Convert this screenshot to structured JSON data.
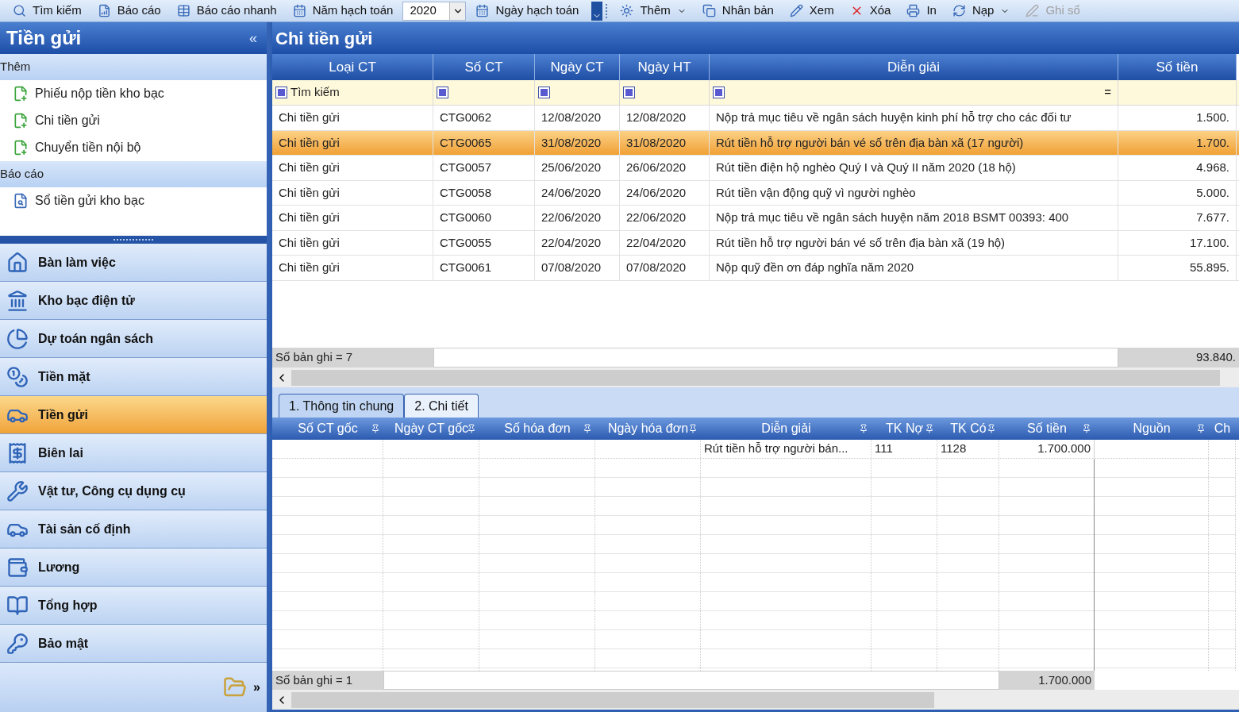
{
  "toolbar": {
    "items": [
      {
        "kind": "button",
        "label": "Tìm kiếm",
        "disabled": false
      },
      {
        "kind": "button",
        "label": "Báo cáo",
        "disabled": false
      },
      {
        "kind": "button",
        "label": "Báo cáo nhanh",
        "disabled": false
      },
      {
        "kind": "label",
        "label": "Năm hạch toán"
      },
      {
        "kind": "select",
        "value": "2020"
      },
      {
        "kind": "button",
        "label": "Ngày hạch toán",
        "disabled": false
      },
      {
        "kind": "overflow"
      },
      {
        "kind": "menu",
        "label": "Thêm",
        "disabled": false
      },
      {
        "kind": "button",
        "label": "Nhân bản",
        "disabled": false
      },
      {
        "kind": "button",
        "label": "Xem",
        "disabled": false
      },
      {
        "kind": "button",
        "label": "Xóa",
        "disabled": false
      },
      {
        "kind": "button",
        "label": "In",
        "disabled": false
      },
      {
        "kind": "menu",
        "label": "Nạp",
        "disabled": false
      },
      {
        "kind": "button",
        "label": "Ghi sổ",
        "disabled": true
      }
    ]
  },
  "sidebar": {
    "title": "Tiền gửi",
    "collapse": "«",
    "groups": [
      {
        "title": "Thêm",
        "items": [
          "Phiếu nộp tiền kho bạc",
          "Chi tiền gửi",
          "Chuyển tiền nội bộ"
        ]
      },
      {
        "title": "Báo cáo",
        "items": [
          "Sổ tiền gửi kho bạc"
        ]
      }
    ],
    "nav": [
      {
        "label": "Bàn làm việc",
        "selected": false
      },
      {
        "label": "Kho bạc điện tử",
        "selected": false
      },
      {
        "label": "Dự toán ngân sách",
        "selected": false
      },
      {
        "label": "Tiền mặt",
        "selected": false
      },
      {
        "label": "Tiền gửi",
        "selected": true
      },
      {
        "label": "Biên lai",
        "selected": false
      },
      {
        "label": "Vật tư, Công cụ dụng cụ",
        "selected": false
      },
      {
        "label": "Tài sản cố định",
        "selected": false
      },
      {
        "label": "Lương",
        "selected": false
      },
      {
        "label": "Tổng hợp",
        "selected": false
      },
      {
        "label": "Bảo mật",
        "selected": false
      }
    ],
    "more": "»"
  },
  "main": {
    "title": "Chi tiền gửi",
    "grid": {
      "columns": [
        "Loại CT",
        "Số CT",
        "Ngày CT",
        "Ngày HT",
        "Diễn giải",
        "Số tiền"
      ],
      "filter": {
        "placeholder": "Tìm kiếm",
        "operator": "="
      },
      "rows": [
        {
          "cells": [
            "Chi tiền gửi",
            "CTG0062",
            "12/08/2020",
            "12/08/2020",
            "Nộp trả mục tiêu về ngân sách huyện kinh phí hỗ trợ cho các đối tư",
            "1.500."
          ],
          "selected": false
        },
        {
          "cells": [
            "Chi tiền gửi",
            "CTG0065",
            "31/08/2020",
            "31/08/2020",
            "Rút tiền hỗ trợ người bán vé số trên địa bàn xã (17 người)",
            "1.700."
          ],
          "selected": true
        },
        {
          "cells": [
            "Chi tiền gửi",
            "CTG0057",
            "25/06/2020",
            "26/06/2020",
            "Rút tiền điện hộ nghèo Quý I và Quý II năm 2020 (18 hộ)",
            "4.968."
          ],
          "selected": false
        },
        {
          "cells": [
            "Chi tiền gửi",
            "CTG0058",
            "24/06/2020",
            "24/06/2020",
            "Rút  tiền vận động quỹ vì người nghèo",
            "5.000."
          ],
          "selected": false
        },
        {
          "cells": [
            "Chi tiền gửi",
            "CTG0060",
            "22/06/2020",
            "22/06/2020",
            "Nộp trả mục tiêu về ngân sách huyện năm 2018 BSMT 00393: 400",
            "7.677."
          ],
          "selected": false
        },
        {
          "cells": [
            "Chi tiền gửi",
            "CTG0055",
            "22/04/2020",
            "22/04/2020",
            "Rút tiền hỗ trợ người bán vé số trên địa bàn xã (19 hộ)",
            "17.100."
          ],
          "selected": false
        },
        {
          "cells": [
            "Chi tiền gửi",
            "CTG0061",
            "07/08/2020",
            "07/08/2020",
            "Nộp quỹ đền ơn đáp nghĩa năm 2020",
            "55.895."
          ],
          "selected": false
        }
      ],
      "footer": {
        "count": "Số bản ghi = 7",
        "total": "93.840."
      }
    },
    "tabs": [
      {
        "label": "1. Thông tin chung",
        "selected": false
      },
      {
        "label": "2. Chi tiết",
        "selected": true
      }
    ],
    "detail": {
      "columns": [
        "Số CT gốc",
        "Ngày CT gốc",
        "Số hóa đơn",
        "Ngày hóa đơn",
        "Diễn giải",
        "TK Nợ",
        "TK Có",
        "Số tiền",
        "Nguồn",
        "Ch"
      ],
      "rows": [
        {
          "cells": [
            "",
            "",
            "",
            "",
            "Rút tiền hỗ trợ người bán...",
            "111",
            "1128",
            "1.700.000",
            "",
            ""
          ]
        }
      ],
      "footer": {
        "count": "Số bản ghi = 1",
        "total": "1.700.000"
      }
    }
  }
}
